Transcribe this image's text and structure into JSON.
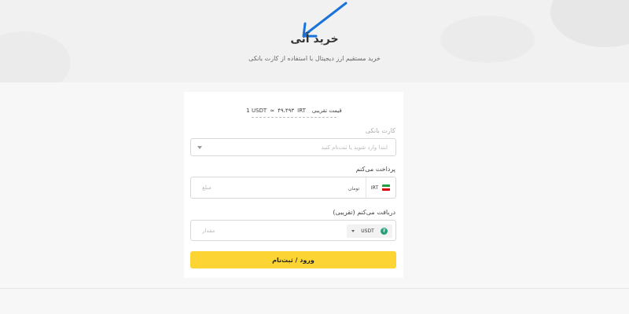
{
  "hero": {
    "title": "خرید آنی",
    "subtitle": "خرید مستقیم ارز دیجیتال با استفاده از کارت بانکی"
  },
  "price": {
    "label": "قیمت تقریبی",
    "currency": "IRT",
    "rate": "۴۹،۴۹۳",
    "approx": "≈",
    "base": "1 USDT"
  },
  "bank_card": {
    "label": "کارت بانکی",
    "placeholder": "ابتدا وارد شوید یا ثبت‌نام کنید"
  },
  "pay": {
    "label": "پرداخت می‌کنم",
    "placeholder": "مبلغ",
    "currency_code": "IRT",
    "unit": "تومان",
    "flag_icon": "iran-flag-icon"
  },
  "receive": {
    "label": "دریافت می‌کنم (تقریبی)",
    "placeholder": "مقدار",
    "currency_code": "USDT",
    "coin_icon": "tether-icon"
  },
  "submit": {
    "label": "ورود / ثبت‌نام"
  },
  "colors": {
    "accent": "#fcd535",
    "arrow": "#1a73d9"
  }
}
